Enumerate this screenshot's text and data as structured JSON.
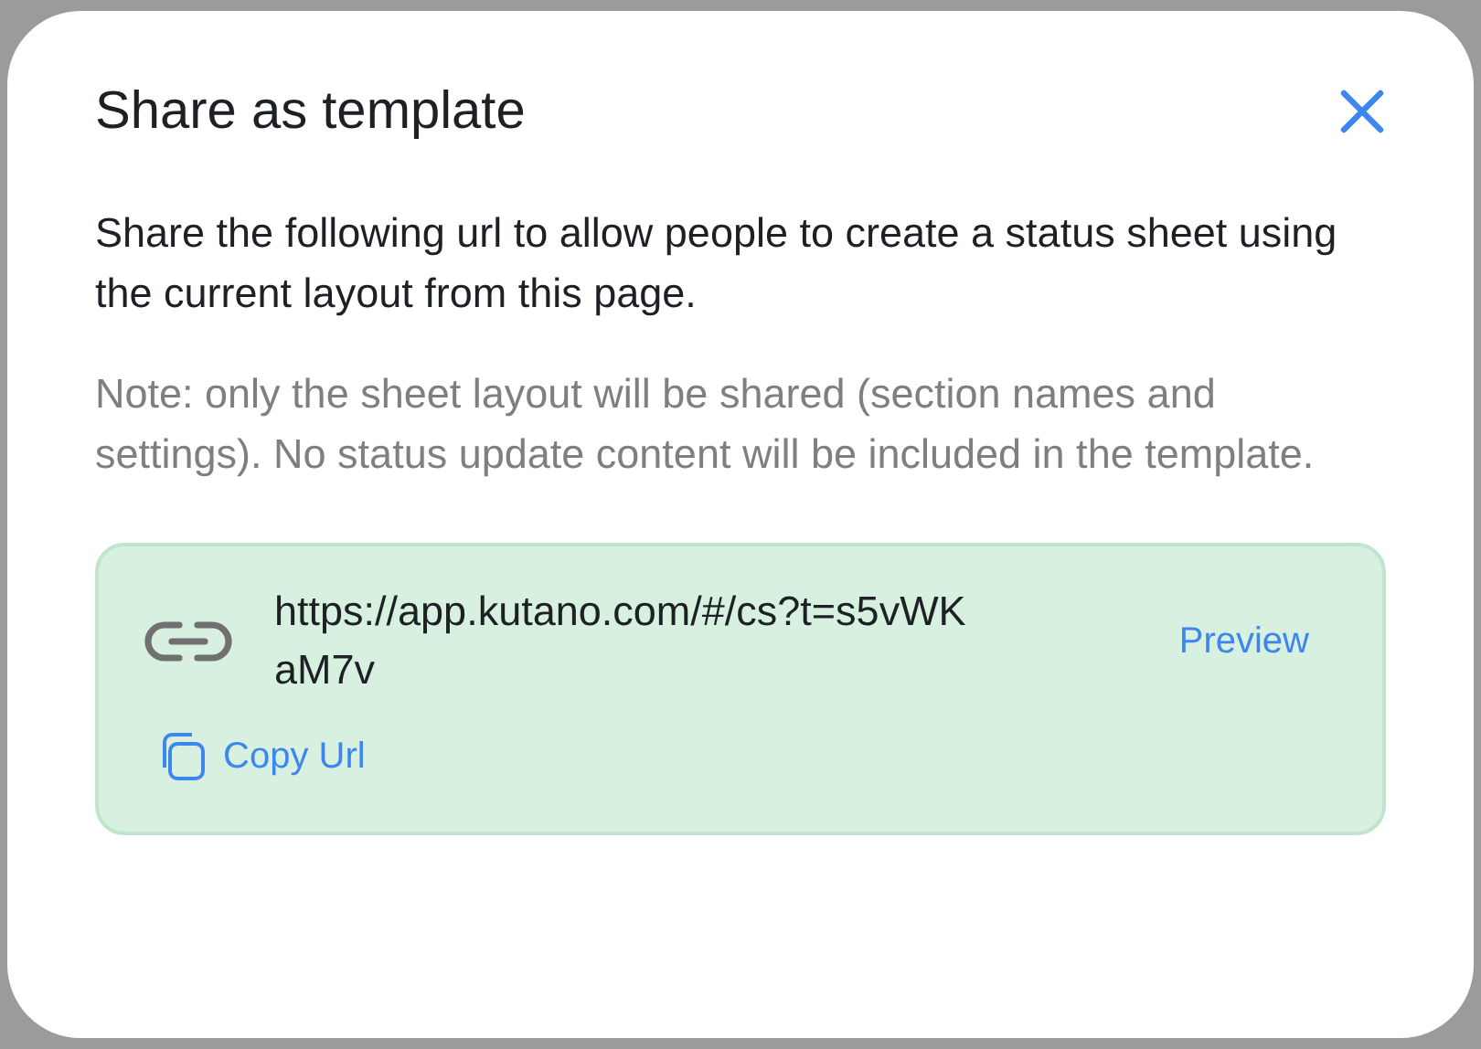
{
  "dialog": {
    "title": "Share as template",
    "description": "Share the following url to allow people to create a status sheet using the current layout from this page.",
    "note": "Note: only the sheet layout will be shared (section names and settings). No status update content will be included in the template.",
    "share_box": {
      "url": "https://app.kutano.com/#/cs?t=s5vWKaM7v",
      "preview_link": "Preview",
      "copy_link": "Copy Url"
    }
  }
}
